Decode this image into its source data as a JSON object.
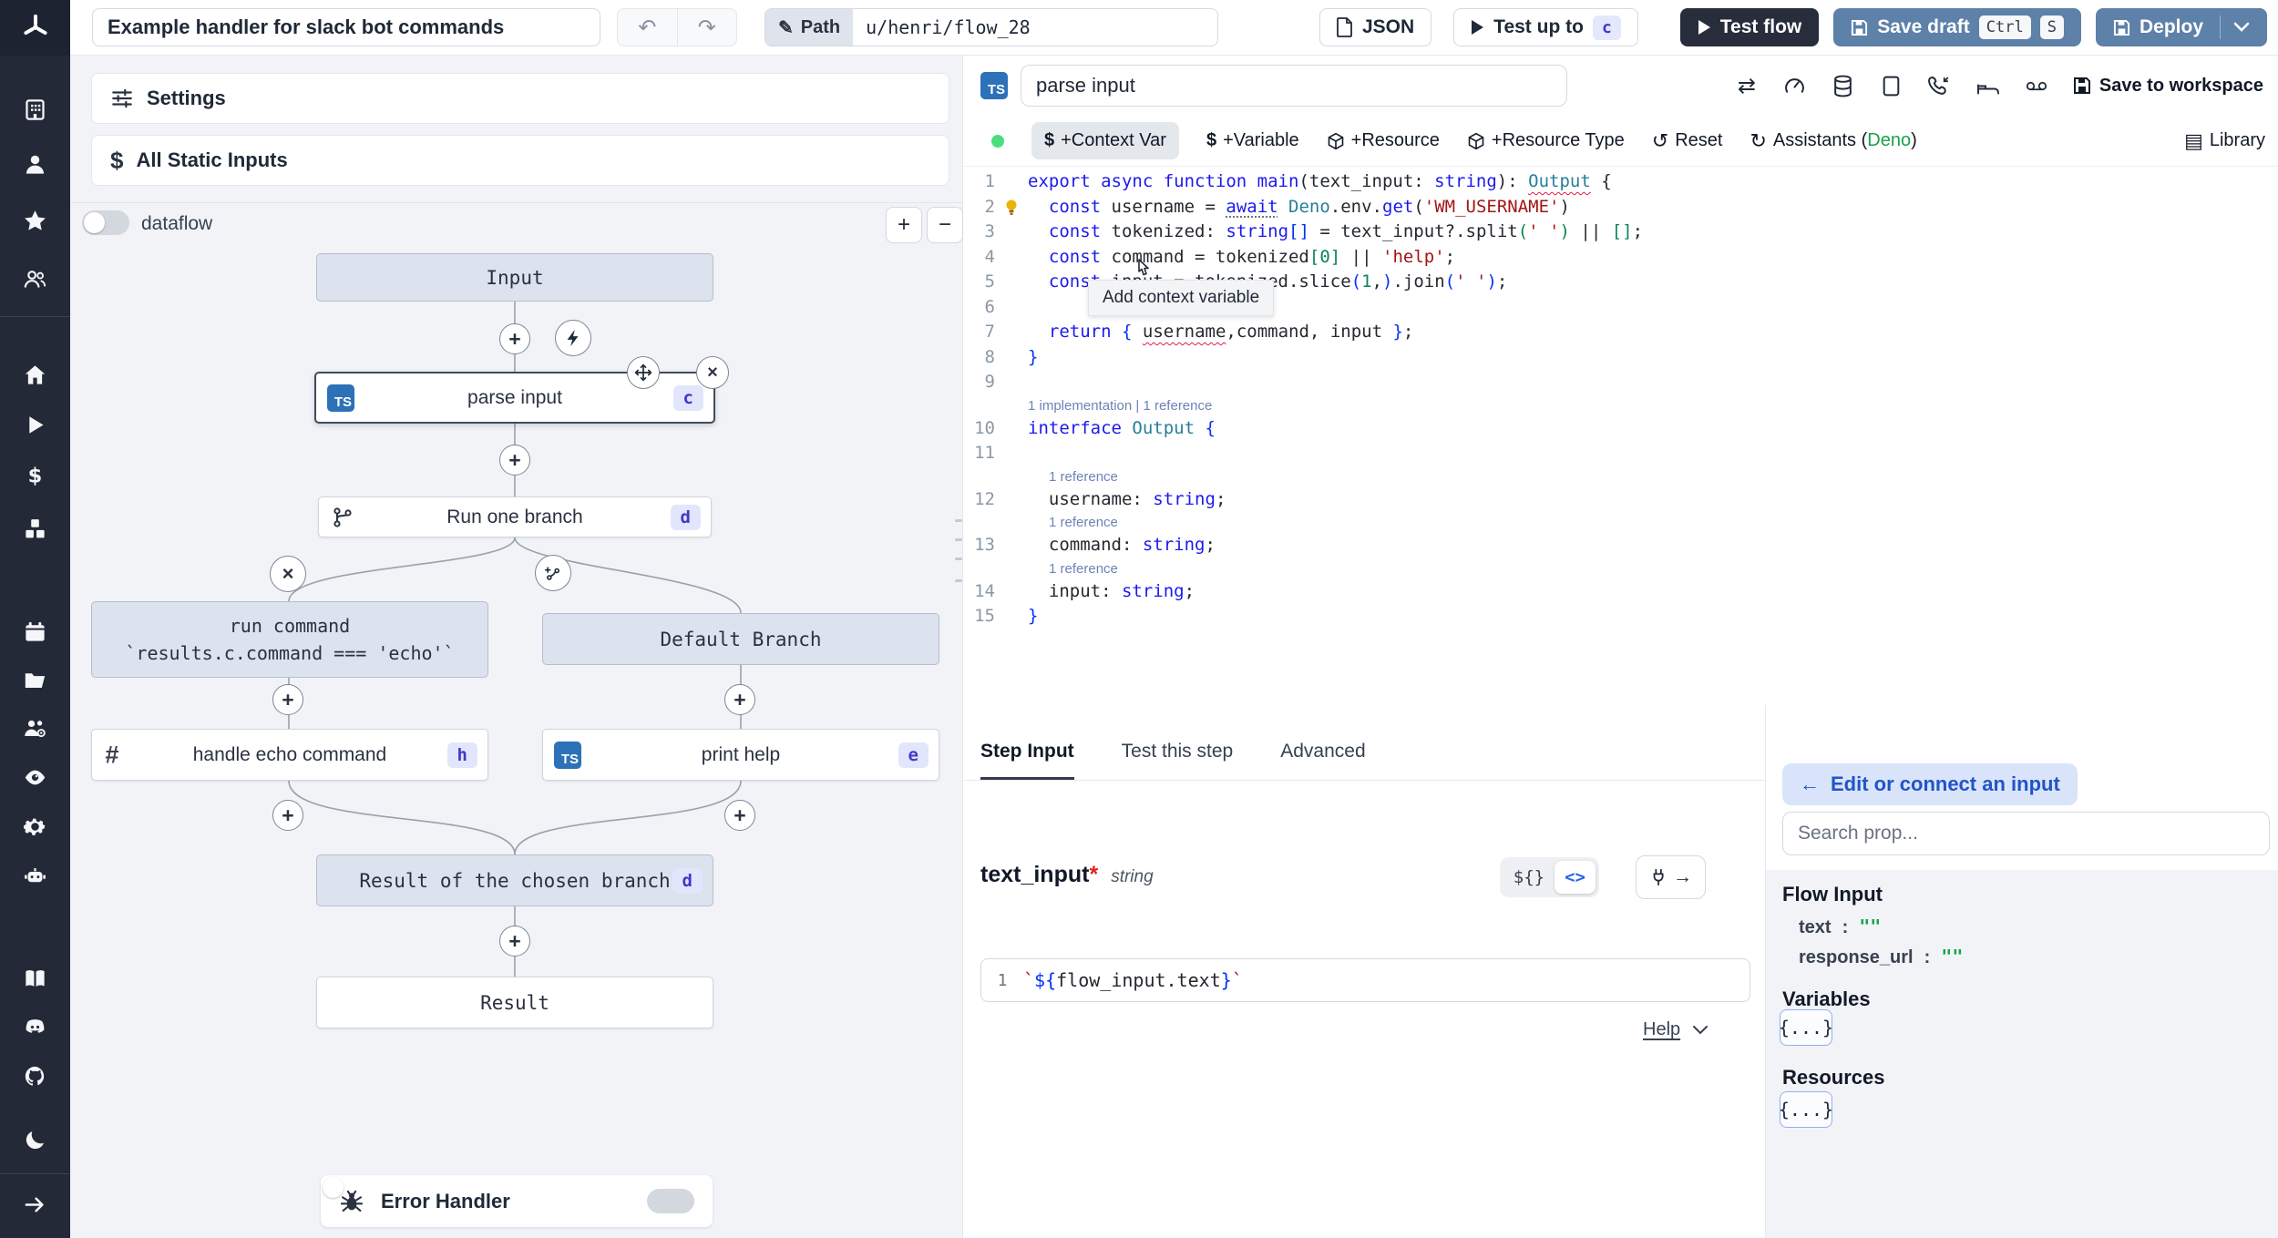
{
  "topbar": {
    "title": "Example handler for slack bot commands",
    "path_label": "Path",
    "path_value": "u/henri/flow_28",
    "json_label": "JSON",
    "test_up_to_label": "Test up to",
    "test_up_to_badge": "c",
    "test_flow_label": "Test flow",
    "save_draft_label": "Save draft",
    "save_kbd": [
      "Ctrl",
      "S"
    ],
    "deploy_label": "Deploy"
  },
  "sidebar": {
    "icons": [
      "workspace",
      "user",
      "favorites",
      "groups",
      "home",
      "runs",
      "variables",
      "resources",
      "schedules",
      "folders",
      "workers",
      "audit-logs",
      "settings",
      "ai",
      "docs",
      "discord",
      "github",
      "dark-mode",
      "expand"
    ]
  },
  "flow": {
    "settings_label": "Settings",
    "static_inputs_label": "All Static Inputs",
    "dataflow_label": "dataflow",
    "zoom_in": "+",
    "zoom_out": "−",
    "nodes": {
      "input": {
        "label": "Input"
      },
      "parse_input": {
        "label": "parse input",
        "badge": "c",
        "lang": "TS"
      },
      "run_one_branch": {
        "label": "Run one branch",
        "badge": "d"
      },
      "run_command": {
        "line1": "run command",
        "line2": "`results.c.command === 'echo'`"
      },
      "default_branch": {
        "label": "Default Branch"
      },
      "handle_echo": {
        "label": "handle echo command",
        "badge": "h"
      },
      "print_help": {
        "label": "print help",
        "badge": "e",
        "lang": "TS"
      },
      "result_chosen": {
        "label": "Result of the chosen branch",
        "badge": "d"
      },
      "result": {
        "label": "Result"
      },
      "error_handler": {
        "label": "Error Handler"
      }
    }
  },
  "editor": {
    "lang_badge": "TS",
    "step_name": "parse input",
    "toolbar": {
      "context_var": "+Context Var",
      "variable": "+Variable",
      "resource": "+Resource",
      "resource_type": "+Resource Type",
      "reset": "Reset",
      "assistants_prefix": "Assistants (",
      "assistants_lang": "Deno",
      "assistants_suffix": ")",
      "library": "Library",
      "save_to_workspace": "Save to workspace"
    },
    "tooltip": "Add context variable",
    "code": {
      "lines": [
        {
          "n": 1,
          "t": [
            [
              "export async function main",
              "kw"
            ],
            [
              "(",
              "pl"
            ],
            [
              "text_input",
              "pl"
            ],
            [
              ": ",
              "pl"
            ],
            [
              "string",
              "kw"
            ],
            [
              "): ",
              "pl"
            ],
            [
              "Output",
              "ty err"
            ],
            [
              " {",
              "pl"
            ]
          ]
        },
        {
          "n": 2,
          "bulb": true,
          "t": [
            [
              "  ",
              "pl"
            ],
            [
              "const ",
              "kw"
            ],
            [
              "username = ",
              "pl"
            ],
            [
              "await",
              "kw dot"
            ],
            [
              " ",
              "pl"
            ],
            [
              "Deno",
              "ty"
            ],
            [
              ".env.",
              "pl"
            ],
            [
              "get",
              "kw"
            ],
            [
              "(",
              "pl"
            ],
            [
              "'WM_USERNAME'",
              "st"
            ],
            [
              ")",
              "pl"
            ]
          ]
        },
        {
          "n": 3,
          "t": [
            [
              "  ",
              "pl"
            ],
            [
              "const ",
              "kw"
            ],
            [
              "tokenized",
              "pl"
            ],
            [
              ": ",
              "pl"
            ],
            [
              "string",
              "kw"
            ],
            [
              "[]",
              "bb"
            ],
            [
              " = ",
              "pl"
            ],
            [
              "text_input?.split",
              "pl"
            ],
            [
              "(",
              "bg2"
            ],
            [
              "' '",
              "st"
            ],
            [
              ")",
              "bg2"
            ],
            [
              " || ",
              "pl"
            ],
            [
              "[]",
              "bg2"
            ],
            [
              ";",
              "pl"
            ]
          ]
        },
        {
          "n": 4,
          "t": [
            [
              "  ",
              "pl"
            ],
            [
              "const ",
              "kw"
            ],
            [
              "command = tokenized",
              "pl"
            ],
            [
              "[",
              "bg2"
            ],
            [
              "0",
              "nu"
            ],
            [
              "]",
              "bg2"
            ],
            [
              " || ",
              "pl"
            ],
            [
              "'help'",
              "st"
            ],
            [
              ";",
              "pl"
            ]
          ]
        },
        {
          "n": 5,
          "t": [
            [
              "  ",
              "pl"
            ],
            [
              "const ",
              "kw"
            ],
            [
              "input = tokenized.slice",
              "pl"
            ],
            [
              "(",
              "bb"
            ],
            [
              "1",
              "nu"
            ],
            [
              ",",
              "pl"
            ],
            [
              ")",
              "bb"
            ],
            [
              ".join",
              "pl"
            ],
            [
              "(",
              "bb"
            ],
            [
              "' '",
              "st"
            ],
            [
              ")",
              "bb"
            ],
            [
              ";",
              "pl"
            ]
          ]
        },
        {
          "n": 6,
          "t": []
        },
        {
          "n": 7,
          "t": [
            [
              "  ",
              "pl"
            ],
            [
              "return",
              "kw"
            ],
            [
              " ",
              "pl"
            ],
            [
              "{ ",
              "bb"
            ],
            [
              "username",
              "pl err"
            ],
            [
              ",",
              "pl"
            ],
            [
              "command",
              "pl"
            ],
            [
              ", ",
              "pl"
            ],
            [
              "input",
              "pl"
            ],
            [
              " }",
              "bb"
            ],
            [
              ";",
              "pl"
            ]
          ]
        },
        {
          "n": 8,
          "t": [
            [
              "}",
              "bb"
            ]
          ]
        },
        {
          "n": 9,
          "t": []
        },
        {
          "lens": "1 implementation | 1 reference",
          "ind": 0
        },
        {
          "n": 10,
          "t": [
            [
              "interface ",
              "kw"
            ],
            [
              "Output",
              "ty"
            ],
            [
              " {",
              "bb"
            ]
          ]
        },
        {
          "n": 11,
          "t": []
        },
        {
          "lens": "1 reference",
          "ind": 1
        },
        {
          "n": 12,
          "t": [
            [
              "  ",
              "pl"
            ],
            [
              "username",
              "pl"
            ],
            [
              ": ",
              "pl"
            ],
            [
              "string",
              "kw"
            ],
            [
              ";",
              "pl"
            ]
          ]
        },
        {
          "lens": "1 reference",
          "ind": 1
        },
        {
          "n": 13,
          "t": [
            [
              "  ",
              "pl"
            ],
            [
              "command",
              "pl"
            ],
            [
              ": ",
              "pl"
            ],
            [
              "string",
              "kw"
            ],
            [
              ";",
              "pl"
            ]
          ]
        },
        {
          "lens": "1 reference",
          "ind": 1
        },
        {
          "n": 14,
          "t": [
            [
              "  ",
              "pl"
            ],
            [
              "input",
              "pl"
            ],
            [
              ": ",
              "pl"
            ],
            [
              "string",
              "kw"
            ],
            [
              ";",
              "pl"
            ]
          ]
        },
        {
          "n": 15,
          "t": [
            [
              "}",
              "bb"
            ]
          ]
        }
      ]
    }
  },
  "step_panel": {
    "tabs": [
      {
        "label": "Step Input"
      },
      {
        "label": "Test this step"
      },
      {
        "label": "Advanced"
      }
    ],
    "field": {
      "name": "text_input",
      "required": "*",
      "type": "string"
    },
    "toggle": {
      "template": "${}",
      "code": "<>"
    },
    "gutter": "1",
    "expr": [
      [
        "`",
        "st"
      ],
      [
        "${",
        "bb"
      ],
      [
        "flow_input.text",
        "pl"
      ],
      [
        "}",
        "bb"
      ],
      [
        "`",
        "st"
      ]
    ],
    "help": "Help"
  },
  "props_panel": {
    "edit_connect_label": "Edit or connect an input",
    "search_placeholder": "Search prop...",
    "flow_input_heading": "Flow Input",
    "rows": [
      {
        "key": "text",
        "sep": ":",
        "value": "\"\""
      },
      {
        "key": "response_url",
        "sep": ":",
        "value": "\"\""
      }
    ],
    "variables_heading": "Variables",
    "resources_heading": "Resources",
    "object_button": "{...}"
  }
}
